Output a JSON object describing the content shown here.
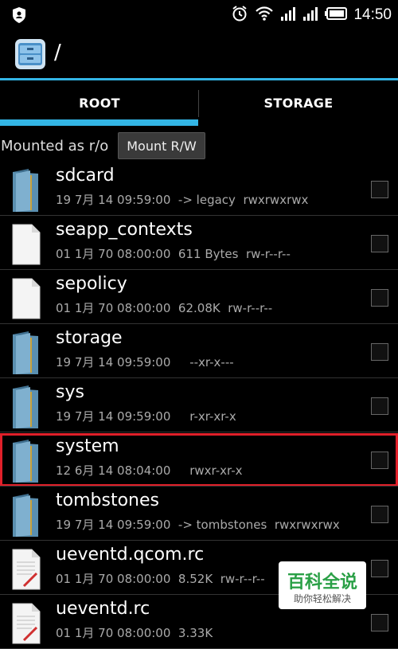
{
  "status_bar": {
    "time": "14:50",
    "icons": [
      "shield-icon",
      "alarm-icon",
      "wifi-icon",
      "signal-icon",
      "signal-icon",
      "battery-icon"
    ]
  },
  "action_bar": {
    "app_icon": "file-manager-icon",
    "path": "/"
  },
  "tabs": [
    {
      "label": "ROOT",
      "selected": true
    },
    {
      "label": "STORAGE",
      "selected": false
    }
  ],
  "mount": {
    "status_text": "Mounted as r/o",
    "button_label": "Mount R/W"
  },
  "files": [
    {
      "name": "sdcard",
      "meta": "19 7月 14 09:59:00  -> legacy  rwxrwxrwx",
      "type": "folder",
      "selected": false
    },
    {
      "name": "seapp_contexts",
      "meta": "01 1月 70 08:00:00  611 Bytes  rw-r--r--",
      "type": "file",
      "selected": false
    },
    {
      "name": "sepolicy",
      "meta": "01 1月 70 08:00:00  62.08K  rw-r--r--",
      "type": "file",
      "selected": false
    },
    {
      "name": "storage",
      "meta": "19 7月 14 09:59:00     --xr-x---",
      "type": "folder",
      "selected": false
    },
    {
      "name": "sys",
      "meta": "19 7月 14 09:59:00     r-xr-xr-x",
      "type": "folder",
      "selected": false
    },
    {
      "name": "system",
      "meta": "12 6月 14 08:04:00     rwxr-xr-x",
      "type": "folder",
      "selected": true
    },
    {
      "name": "tombstones",
      "meta": "19 7月 14 09:59:00  -> tombstones  rwxrwxrwx",
      "type": "folder",
      "selected": false
    },
    {
      "name": "ueventd.qcom.rc",
      "meta": "01 1月 70 08:00:00  8.52K  rw-r--r--",
      "type": "text-file",
      "selected": false
    },
    {
      "name": "ueventd.rc",
      "meta": "01 1月 70 08:00:00  3.33K",
      "type": "text-file",
      "selected": false
    }
  ],
  "watermark": {
    "title": "百科全说",
    "subtitle": "助你轻松解决"
  },
  "colors": {
    "accent": "#33b5e5",
    "selection_outline": "#e0202a",
    "folder": "#5a8fb0"
  }
}
